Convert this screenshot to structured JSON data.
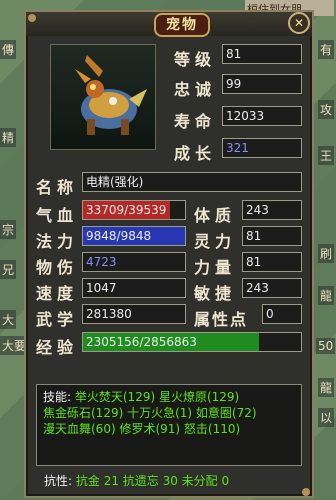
{
  "background": {
    "top_label": "桓住到女朋",
    "left_labels": [
      "傳",
      "精",
      "宗",
      "兄",
      "大",
      "大要"
    ],
    "right_labels": [
      "有",
      "攻",
      "王",
      "刷",
      "龍",
      "50",
      "龍",
      "以"
    ]
  },
  "window": {
    "title": "宠物",
    "close_label": "✕"
  },
  "pet": {
    "level": {
      "label": "等级",
      "value": "81"
    },
    "loyalty": {
      "label": "忠诚",
      "value": "99"
    },
    "lifespan": {
      "label": "寿命",
      "value": "12033"
    },
    "growth": {
      "label": "成长",
      "value": "321"
    },
    "name": {
      "label": "名称",
      "value": "电精(强化)"
    }
  },
  "stats": {
    "hp": {
      "label": "气血",
      "value": "33709/39539",
      "fill": 0.8525,
      "color": "#b42828"
    },
    "mp": {
      "label": "法力",
      "value": "9848/9848",
      "fill": 1.0,
      "color": "#2838b4"
    },
    "phys": {
      "label": "物伤",
      "value": "4723"
    },
    "speed": {
      "label": "速度",
      "value": "1047"
    },
    "martial": {
      "label": "武学",
      "value": "281380"
    },
    "exp": {
      "label": "经验",
      "value": "2305156/2856863",
      "fill": 0.8069,
      "color": "#1e8c1e"
    },
    "con": {
      "label": "体质",
      "value": "243"
    },
    "spirit": {
      "label": "灵力",
      "value": "81"
    },
    "str": {
      "label": "力量",
      "value": "81"
    },
    "agi": {
      "label": "敏捷",
      "value": "243"
    },
    "points": {
      "label": "属性点",
      "value": "0"
    }
  },
  "skills": {
    "label": "技能:",
    "line1": "举火焚天(129) 星火燎原(129)",
    "line2": "焦金砾石(129) 十万火急(1) 如意圈(72)",
    "line3": "漫天血舞(60) 修罗术(91) 怒击(110)"
  },
  "resist": {
    "label": "抗性:",
    "value": "抗金 21 抗遗忘 30 未分配 0"
  }
}
